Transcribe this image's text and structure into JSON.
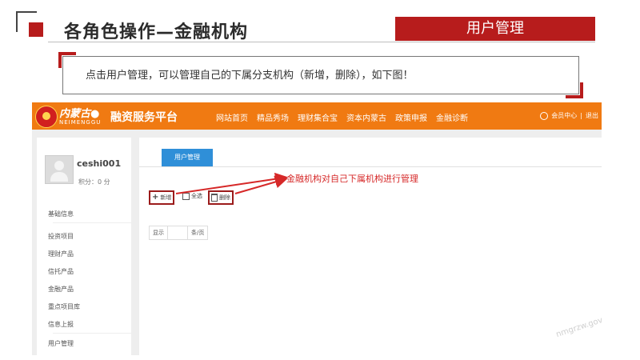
{
  "slide": {
    "title": "各角色操作—金融机构",
    "tag": "用户管理",
    "note": "点击用户管理，可以管理自己的下属分支机构（新增，删除），如下图！",
    "watermark": "nmgrzw.gov"
  },
  "app": {
    "brand": "内蒙古●",
    "brand_sub": "NEIMENGGU",
    "platform": "融资服务平台",
    "nav": [
      "网站首页",
      "精品秀场",
      "理财集合宝",
      "资本内蒙古",
      "政策申报",
      "金融诊断"
    ],
    "member_center": "会员中心",
    "separator": "|",
    "logout": "退出",
    "user": {
      "name": "ceshi001",
      "points": "积分：0 分"
    },
    "menu": [
      "基础信息",
      "投资项目",
      "理财产品",
      "信托产品",
      "金融产品",
      "重点项目库",
      "信息上报",
      "用户管理"
    ],
    "tab": "用户管理",
    "toolbar": {
      "add": "新增",
      "select_all": "全选",
      "delete": "删除"
    },
    "page_size": {
      "show": "显示",
      "per_page": "条/页"
    }
  },
  "annotation": "金融机构对自己下属机构进行管理",
  "colors": {
    "accent_red": "#b71c1c",
    "nav_orange": "#f07a12",
    "tab_blue": "#2f8fd8",
    "annotation_red": "#d62828"
  }
}
